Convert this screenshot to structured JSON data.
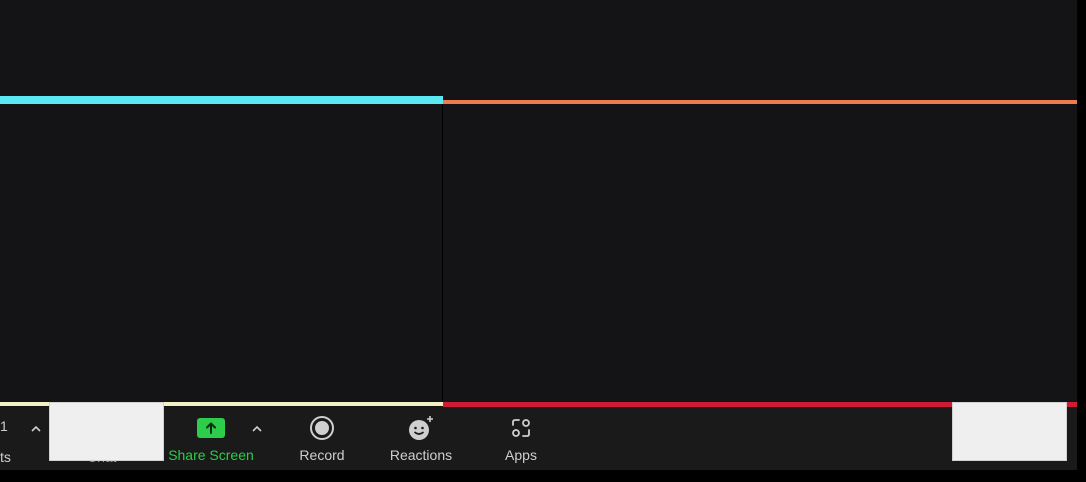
{
  "toolbar": {
    "participants_count": "1",
    "participants_partial_label": "ts",
    "chat_label": "Chat",
    "share_screen_label": "Share Screen",
    "record_label": "Record",
    "reactions_label": "Reactions",
    "apps_label": "Apps",
    "caret": "^"
  },
  "colors": {
    "tile_top_left_border": "#5ae8f5",
    "tile_top_right_border": "#ef7b4c",
    "tile_bottom_left_border": "#f4f0c4",
    "tile_bottom_right_border": "#d11a35",
    "share_screen_green": "#2ccd4a",
    "share_screen_label": "#2ccd4a"
  },
  "icons": {
    "participants": "participants-icon",
    "chat": "chat-icon",
    "share_screen": "share-screen-icon",
    "record": "record-icon",
    "reactions": "reactions-icon",
    "apps": "apps-icon"
  }
}
